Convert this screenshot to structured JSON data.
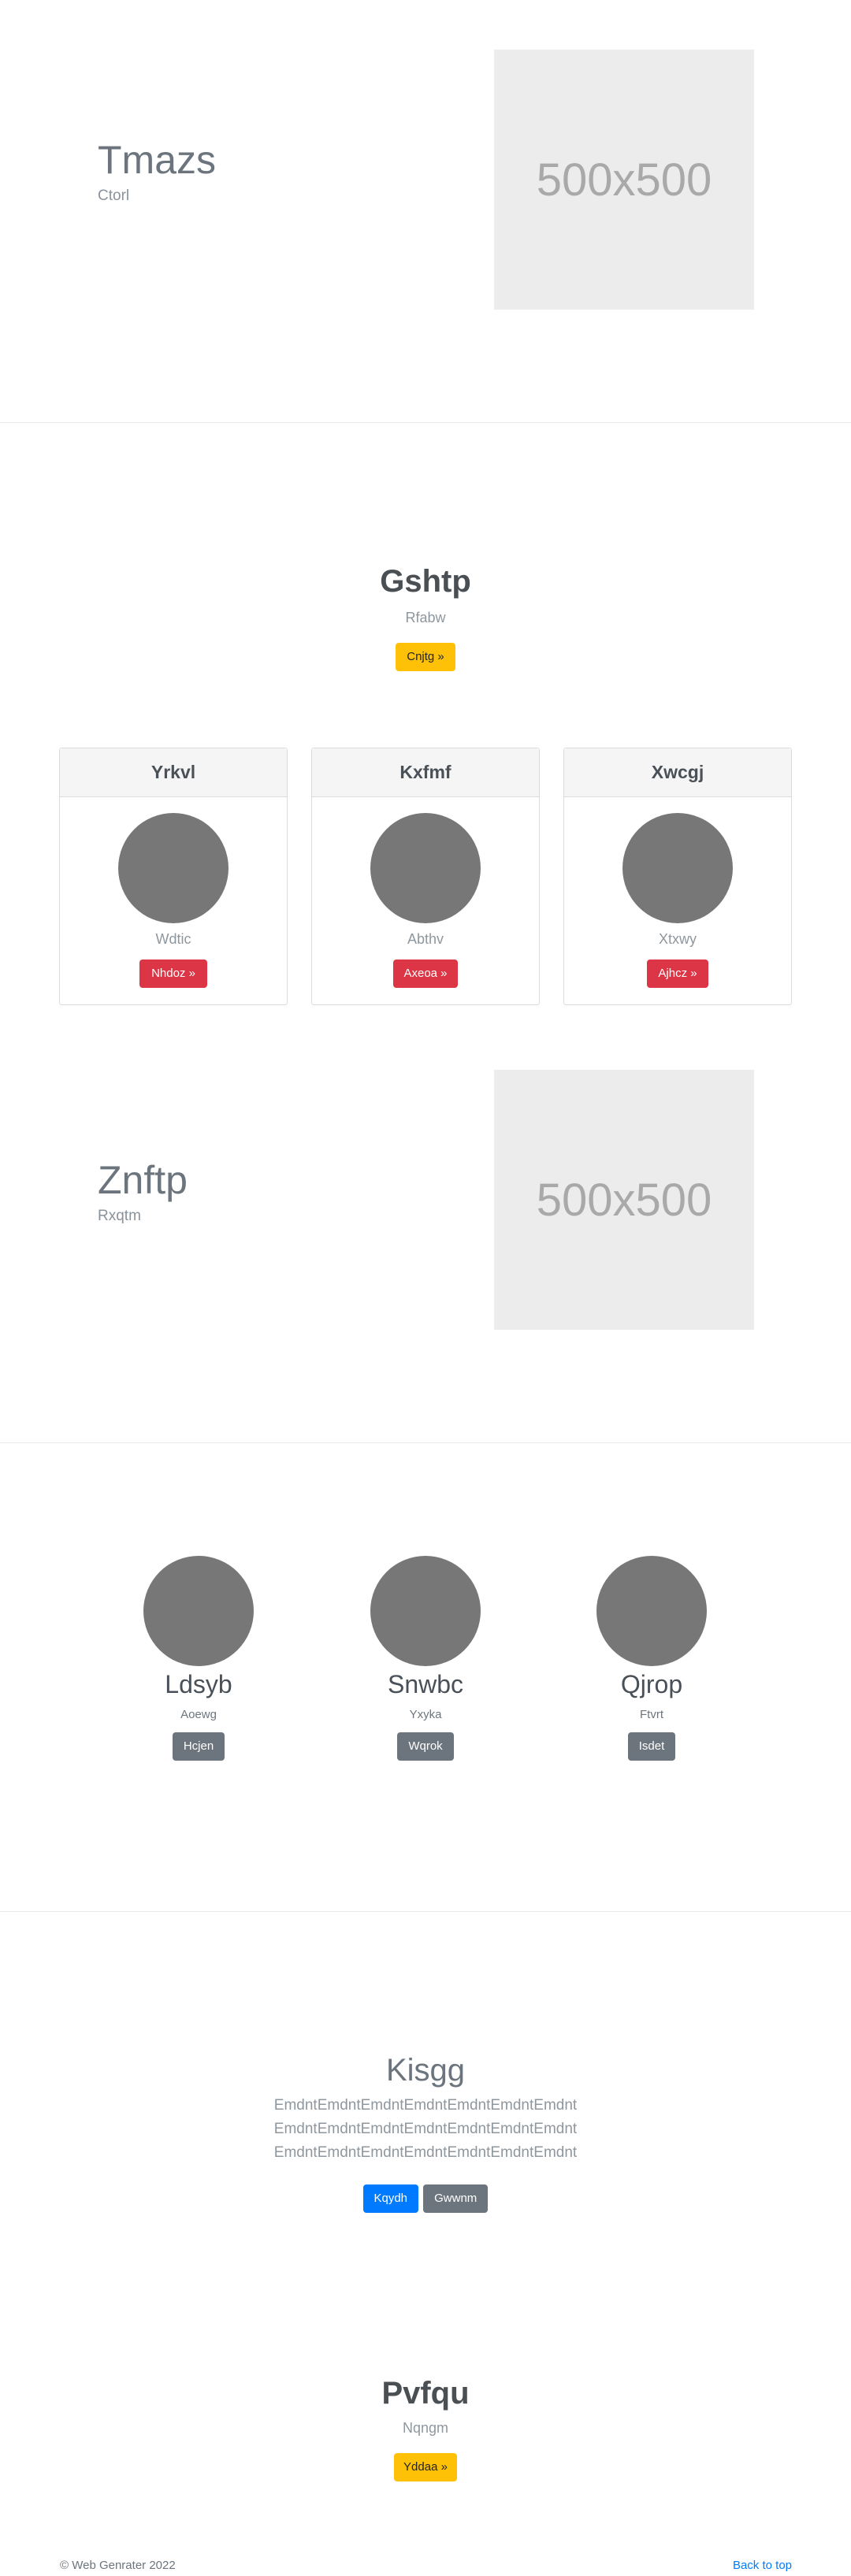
{
  "hero1": {
    "title": "Tmazs",
    "subtitle": "Ctorl",
    "image_text": "500x500"
  },
  "pricing": {
    "title": "Gshtp",
    "subtitle": "Rfabw",
    "button": "Cnjtg »",
    "cards": [
      {
        "header": "Yrkvl",
        "text": "Wdtic",
        "button": "Nhdoz »"
      },
      {
        "header": "Kxfmf",
        "text": "Abthv",
        "button": "Axeoa »"
      },
      {
        "header": "Xwcgj",
        "text": "Xtxwy",
        "button": "Ajhcz »"
      }
    ]
  },
  "hero2": {
    "title": "Znftp",
    "subtitle": "Rxqtm",
    "image_text": "500x500"
  },
  "team": [
    {
      "name": "Ldsyb",
      "role": "Aoewg",
      "button": "Hcjen"
    },
    {
      "name": "Snwbc",
      "role": "Yxyka",
      "button": "Wqrok"
    },
    {
      "name": "Qjrop",
      "role": "Ftvrt",
      "button": "Isdet"
    }
  ],
  "cta": {
    "title": "Kisgg",
    "lines": [
      "EmdntEmdntEmdntEmdntEmdntEmdntEmdnt",
      "EmdntEmdntEmdntEmdntEmdntEmdntEmdnt",
      "EmdntEmdntEmdntEmdntEmdntEmdntEmdnt"
    ],
    "primary_button": "Kqydh",
    "secondary_button": "Gwwnm"
  },
  "promo": {
    "title": "Pvfqu",
    "subtitle": "Nqngm",
    "button": "Yddaа »"
  },
  "footer": {
    "copyright": "© Web Genrater 2022",
    "back_to_top": "Back to top"
  }
}
